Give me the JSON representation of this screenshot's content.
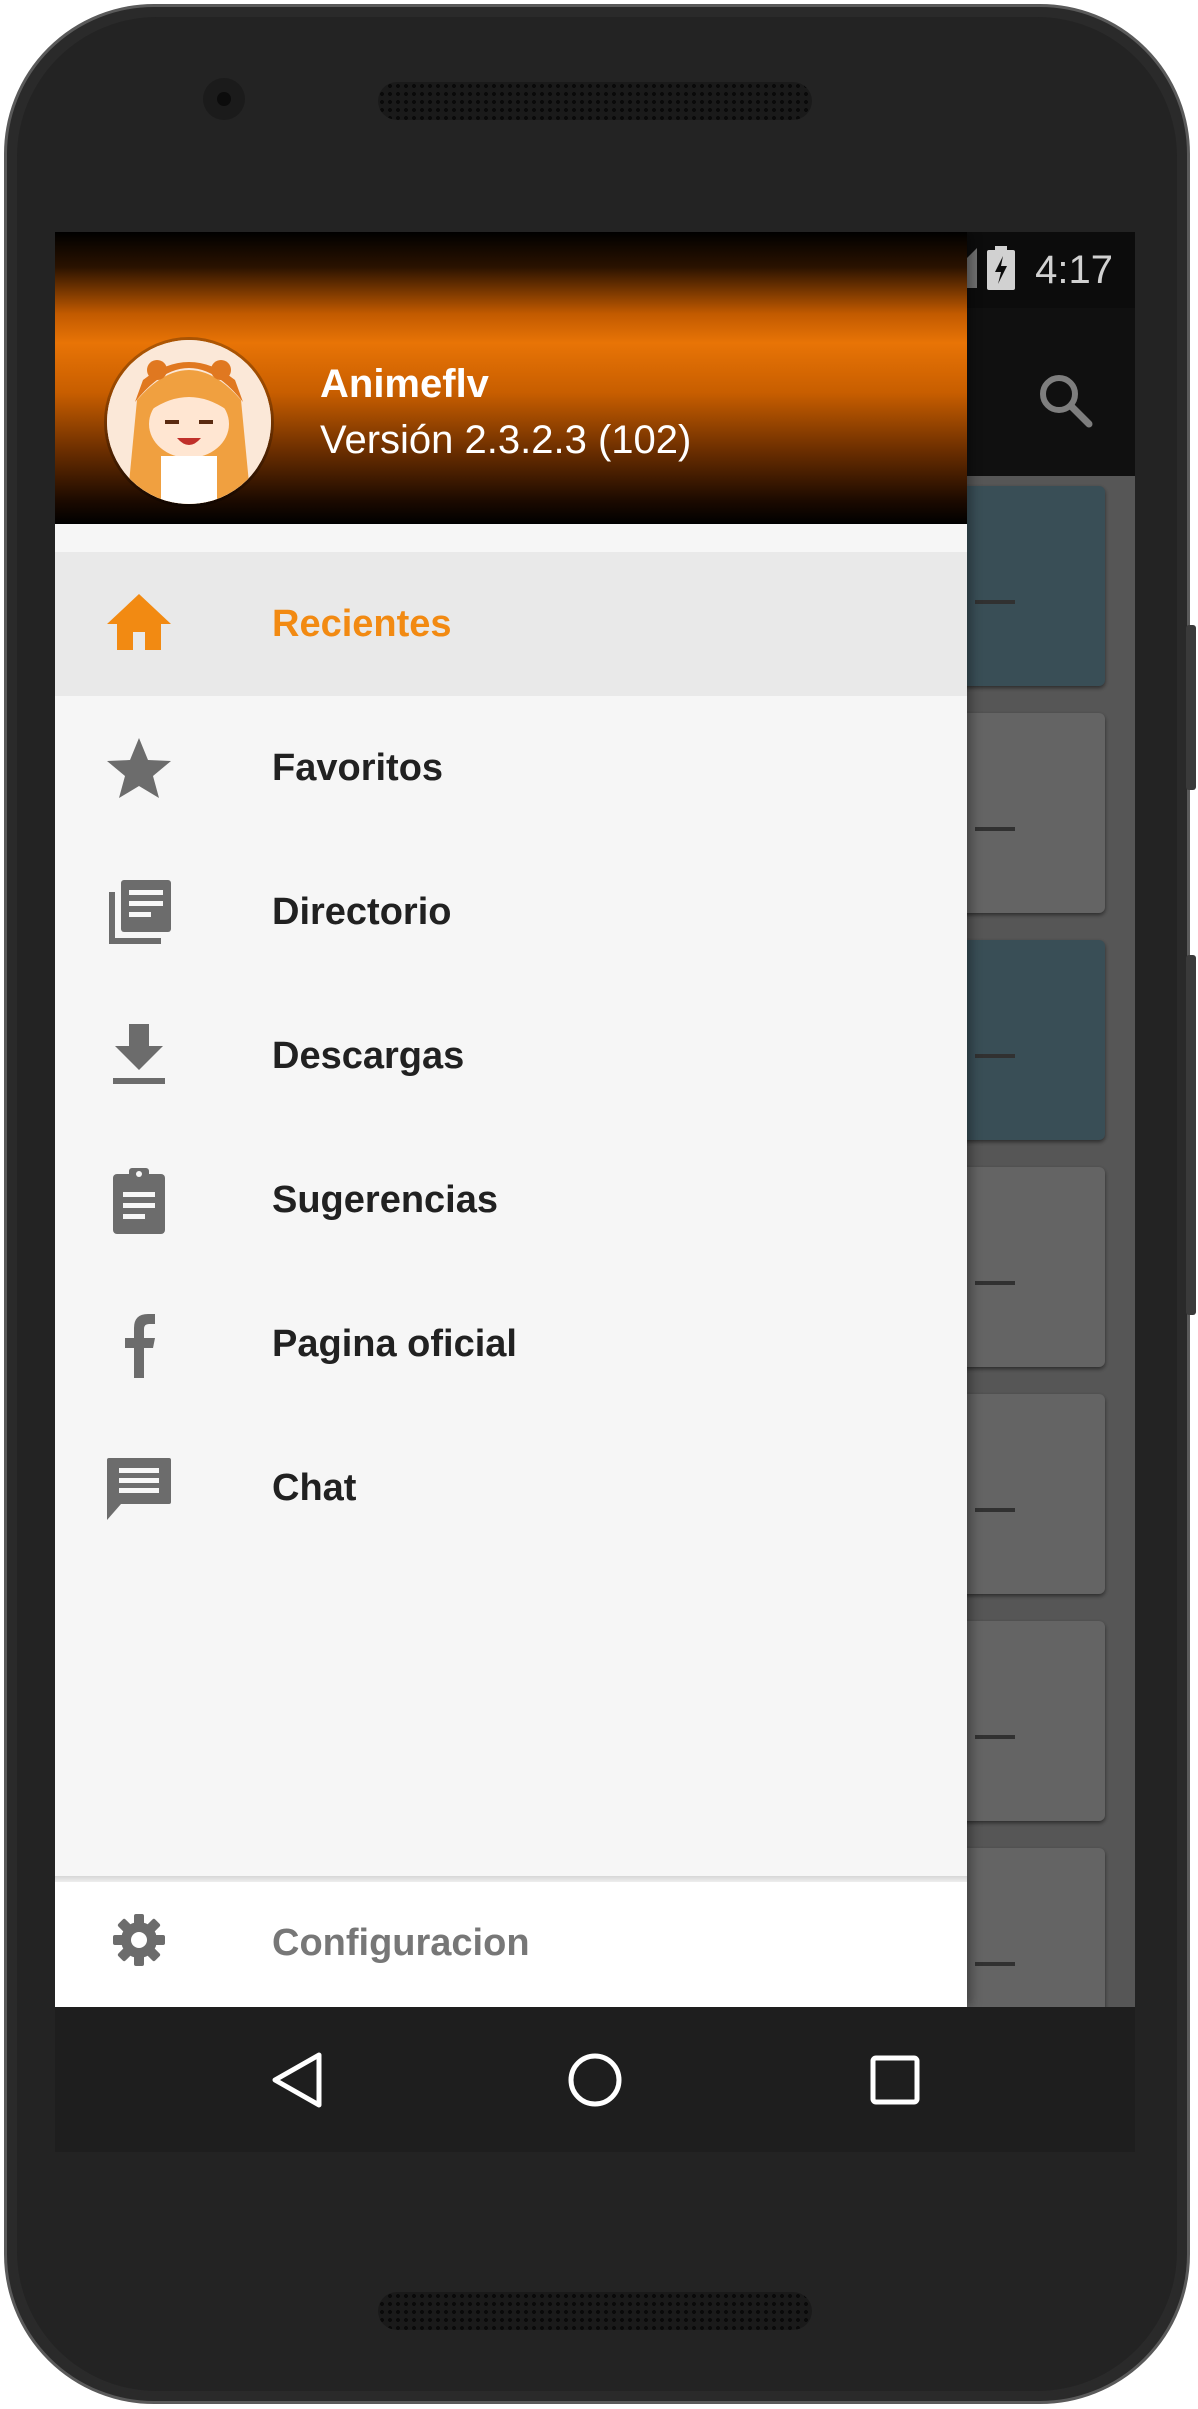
{
  "status_bar": {
    "time": "4:17"
  },
  "toolbar": {
    "search_icon": "search-icon"
  },
  "drawer": {
    "header": {
      "app_name": "Animeflv",
      "version": "Versión 2.3.2.3 (102)"
    },
    "items": [
      {
        "label": "Recientes",
        "icon": "home-icon",
        "active": true
      },
      {
        "label": "Favoritos",
        "icon": "star-icon",
        "active": false
      },
      {
        "label": "Directorio",
        "icon": "library-icon",
        "active": false
      },
      {
        "label": "Descargas",
        "icon": "download-icon",
        "active": false
      },
      {
        "label": "Sugerencias",
        "icon": "clipboard-icon",
        "active": false
      },
      {
        "label": "Pagina oficial",
        "icon": "facebook-icon",
        "active": false
      },
      {
        "label": "Chat",
        "icon": "chat-icon",
        "active": false
      }
    ],
    "footer": {
      "label": "Configuracion",
      "icon": "gear-icon"
    }
  },
  "colors": {
    "accent": "#f28a12",
    "header_orange": "#e87406",
    "active_row_bg": "#e9e9e9",
    "teal_card": "#46606a"
  },
  "navigation_bar": {
    "buttons": [
      "back-icon",
      "home-circle-icon",
      "recents-square-icon"
    ]
  }
}
